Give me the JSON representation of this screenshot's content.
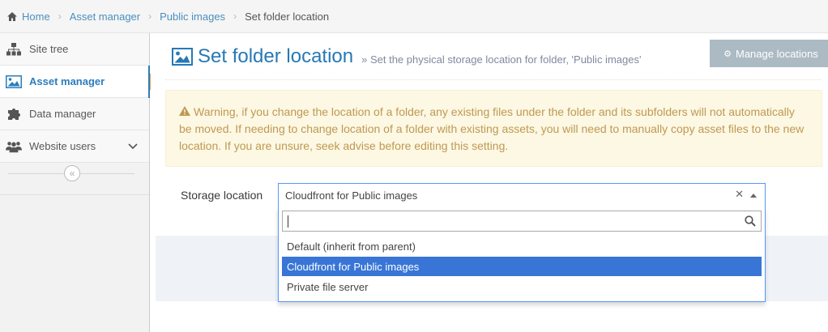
{
  "breadcrumb": {
    "items": [
      "Home",
      "Asset manager",
      "Public images",
      "Set folder location"
    ]
  },
  "sidebar": {
    "items": [
      {
        "label": "Site tree",
        "icon": "sitemap-icon"
      },
      {
        "label": "Asset manager",
        "icon": "image-icon",
        "active": true
      },
      {
        "label": "Data manager",
        "icon": "puzzle-icon"
      },
      {
        "label": "Website users",
        "icon": "users-icon",
        "has_submenu": true
      }
    ],
    "collapse_glyph": "«"
  },
  "header": {
    "title": "Set folder location",
    "subtitle": "» Set the physical storage location for folder, 'Public images'",
    "manage_button": "Manage locations"
  },
  "warning": {
    "text": "Warning, if you change the location of a folder, any existing files under the folder and its subfolders will not automatically be moved. If needing to change location of a folder with existing assets, you will need to manually copy asset files to the new location. If you are unsure, seek advise before editing this setting."
  },
  "form": {
    "storage_label": "Storage location",
    "selected_value": "Cloudfront for Public images",
    "search_value": "",
    "options": [
      {
        "label": "Default (inherit from parent)",
        "highlighted": false
      },
      {
        "label": "Cloudfront for Public images",
        "highlighted": true
      },
      {
        "label": "Private file server",
        "highlighted": false
      }
    ]
  },
  "colors": {
    "accent": "#2679b5",
    "active_arrow": "#f0a14a",
    "warning_bg": "#fcf8e3",
    "warning_text": "#c09853",
    "highlight": "#3875d7",
    "button_bg": "#abbac3"
  }
}
